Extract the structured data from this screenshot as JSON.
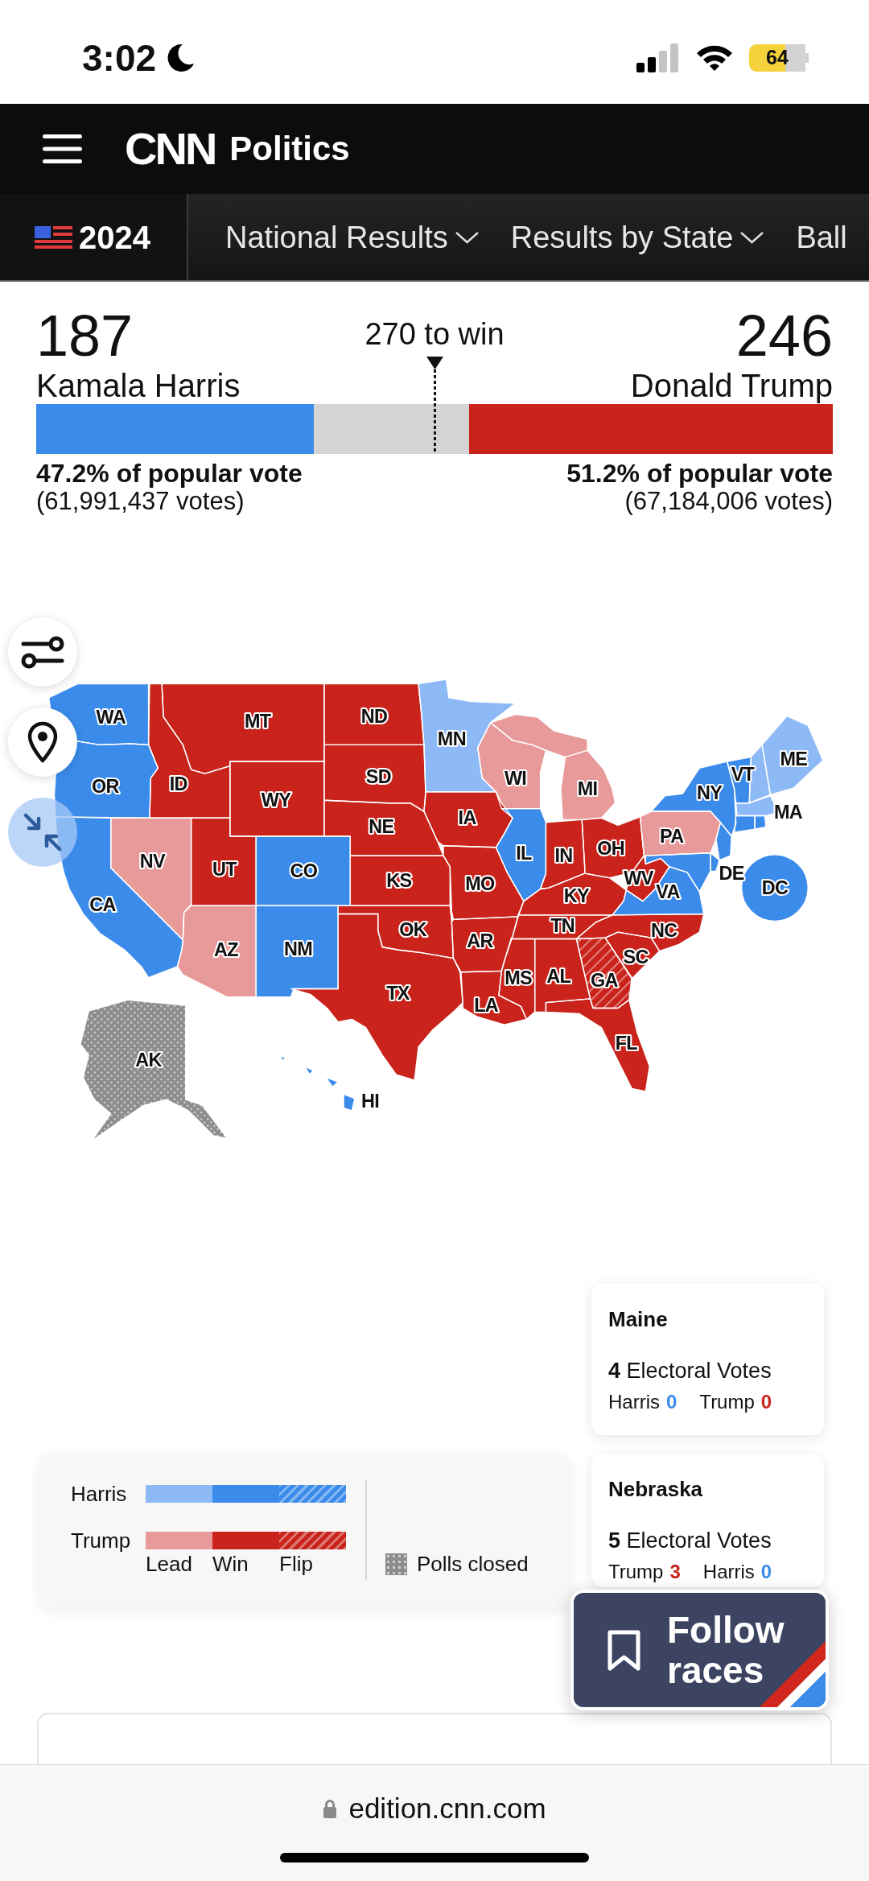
{
  "status_bar": {
    "time": "3:02",
    "battery": "64"
  },
  "header": {
    "logo": "CNN",
    "section": "Politics"
  },
  "nav": {
    "year": "2024",
    "items": [
      {
        "label": "National Results",
        "dropdown": true
      },
      {
        "label": "Results by State",
        "dropdown": true
      },
      {
        "label": "Ball",
        "dropdown": false
      }
    ]
  },
  "scoreboard": {
    "goal": "270 to win",
    "candidates": [
      {
        "votes": "187",
        "name": "Kamala Harris",
        "level": 0.348,
        "color": "#3b8beb",
        "popular_share": "47.2% of popular vote",
        "popular_count": "(61,991,437 votes)"
      },
      {
        "votes": "246",
        "name": "Donald Trump",
        "level": 0.457,
        "color": "#c9231b",
        "popular_share": "51.2% of popular vote",
        "popular_count": "(67,184,006 votes)"
      }
    ]
  },
  "map": {
    "states": [
      {
        "label": "WA",
        "color": "#3b8beb",
        "kind": "solid"
      },
      {
        "label": "OR",
        "color": "#3b8beb",
        "kind": "solid"
      },
      {
        "label": "ID",
        "color": "#c9231b",
        "kind": "solid"
      },
      {
        "label": "MT",
        "color": "#c9231b",
        "kind": "solid"
      },
      {
        "label": "ND",
        "color": "#c9231b",
        "kind": "solid"
      },
      {
        "label": "SD",
        "color": "#c9231b",
        "kind": "solid"
      },
      {
        "label": "MN",
        "color": "#8dbaf6",
        "kind": "solid"
      },
      {
        "label": "WI",
        "color": "#e89a9b",
        "kind": "solid"
      },
      {
        "label": "MI",
        "color": "#e89a9b",
        "kind": "solid"
      },
      {
        "label": "NY",
        "color": "#3b8beb",
        "kind": "solid"
      },
      {
        "label": "VT",
        "color": "#3b8beb",
        "kind": "solid"
      },
      {
        "color": "#8dbaf6",
        "kind": "solid"
      },
      {
        "label": "ME",
        "color": "#8dbaf6",
        "kind": "solid"
      },
      {
        "label": "CA",
        "color": "#3b8beb",
        "kind": "solid"
      },
      {
        "label": "NV",
        "color": "#e89a9b",
        "kind": "solid"
      },
      {
        "label": "UT",
        "color": "#c9231b",
        "kind": "solid"
      },
      {
        "label": "WY",
        "color": "#c9231b",
        "kind": "solid"
      },
      {
        "label": "CO",
        "color": "#3b8beb",
        "kind": "solid"
      },
      {
        "label": "NE",
        "color": "#c9231b",
        "kind": "solid"
      },
      {
        "label": "IA",
        "color": "#c9231b",
        "kind": "solid"
      },
      {
        "label": "KS",
        "color": "#c9231b",
        "kind": "solid"
      },
      {
        "label": "MO",
        "color": "#c9231b",
        "kind": "solid"
      },
      {
        "label": "IL",
        "color": "#3b8beb",
        "kind": "solid"
      },
      {
        "label": "IN",
        "color": "#c9231b",
        "kind": "solid"
      },
      {
        "label": "KY",
        "color": "#c9231b",
        "kind": "solid"
      },
      {
        "label": "OH",
        "color": "#c9231b",
        "kind": "solid"
      },
      {
        "label": "PA",
        "color": "#e89a9b",
        "kind": "solid"
      },
      {
        "label": "WV",
        "color": "#c9231b",
        "kind": "solid"
      },
      {
        "label": "VA",
        "color": "#3b8beb",
        "kind": "solid"
      },
      {
        "color": "#3b8beb",
        "kind": "solid"
      },
      {
        "label": "DE",
        "color": "#3b8beb",
        "kind": "solid"
      },
      {
        "color": "#3b8beb",
        "kind": "solid"
      },
      {
        "label": "MA",
        "color": "#8dbaf6",
        "kind": "solid"
      },
      {
        "color": "#3b8beb",
        "kind": "solid"
      },
      {
        "color": "#3b8beb",
        "kind": "solid"
      },
      {
        "label": "AZ",
        "color": "#e89a9b",
        "kind": "solid"
      },
      {
        "label": "AK",
        "color": "#8c8c8c",
        "kind": "dotted"
      },
      {
        "label": "NM",
        "color": "#3b8beb",
        "kind": "solid"
      },
      {
        "label": "HI",
        "color": "#3b8beb",
        "kind": "solid"
      },
      {
        "label": "TX",
        "color": "#c9231b",
        "kind": "solid"
      },
      {
        "label": "OK",
        "color": "#c9231b",
        "kind": "solid"
      },
      {
        "label": "AR",
        "color": "#c9231b",
        "kind": "solid"
      },
      {
        "label": "TN",
        "color": "#c9231b",
        "kind": "solid"
      },
      {
        "label": "LA",
        "color": "#c9231b",
        "kind": "solid"
      },
      {
        "label": "MS",
        "color": "#c9231b",
        "kind": "solid"
      },
      {
        "label": "AL",
        "color": "#c9231b",
        "kind": "solid"
      },
      {
        "label": "GA",
        "color": "#c9231b",
        "kind": "striped"
      },
      {
        "label": "SC",
        "color": "#c9231b",
        "kind": "solid"
      },
      {
        "label": "NC",
        "color": "#c9231b",
        "kind": "solid"
      },
      {
        "label": "FL",
        "color": "#c9231b",
        "kind": "solid"
      },
      {
        "label": "DC",
        "color": "#3b8beb",
        "kind": "solid"
      }
    ]
  },
  "legend": {
    "rows": [
      {
        "name": "Harris",
        "swatches": [
          {
            "color": "#8dbaf6",
            "kind": "solid"
          },
          {
            "color": "#3b8beb",
            "kind": "solid"
          },
          {
            "color": "#3b8beb",
            "kind": "striped"
          }
        ]
      },
      {
        "name": "Trump",
        "swatches": [
          {
            "color": "#e89a9b",
            "kind": "solid"
          },
          {
            "color": "#c9231b",
            "kind": "solid"
          },
          {
            "color": "#c9231b",
            "kind": "striped"
          }
        ]
      }
    ],
    "columns": [
      "Lead",
      "Win",
      "Flip"
    ],
    "polls_closed": {
      "label": "Polls closed",
      "color": "#8c8c8c",
      "kind": "dotted"
    }
  },
  "race_cards": [
    {
      "state": "Maine",
      "electoral_votes": "**4** Electoral Votes",
      "results": [
        {
          "name": "Harris",
          "votes": "0",
          "color": "#3b8beb"
        },
        {
          "name": "Trump",
          "votes": "0",
          "color": "#c9231b"
        }
      ]
    },
    {
      "state": "Nebraska",
      "electoral_votes": "**5** Electoral Votes",
      "results": [
        {
          "name": "Trump",
          "votes": "3",
          "color": "#c9231b"
        },
        {
          "name": "Harris",
          "votes": "0",
          "color": "#3b8beb"
        }
      ]
    }
  ],
  "follow_button": {
    "label": "Follow races"
  },
  "browser": {
    "url": "edition.cnn.com"
  }
}
